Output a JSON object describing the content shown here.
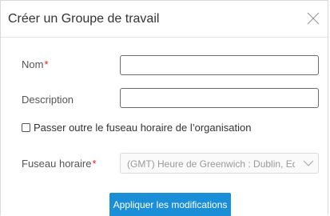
{
  "dialog": {
    "title": "Créer un Groupe de travail",
    "close_icon": "close-icon"
  },
  "form": {
    "name_label": "Nom",
    "name_required_mark": "*",
    "name_value": "",
    "description_label": "Description",
    "description_value": "",
    "override_timezone_label": "Passer outre le fuseau horaire de l’organisation",
    "override_timezone_checked": false,
    "timezone_label": "Fuseau horaire",
    "timezone_required_mark": "*",
    "timezone_value": "(GMT) Heure de Greenwich : Dublin, Edimbourg",
    "timezone_chevron_icon": "chevron-down-icon"
  },
  "actions": {
    "apply_label": "Appliquer les modifications",
    "apply_color": "#1a8fd8"
  },
  "colors": {
    "required": "#e02020",
    "border": "#d9d9d9"
  }
}
